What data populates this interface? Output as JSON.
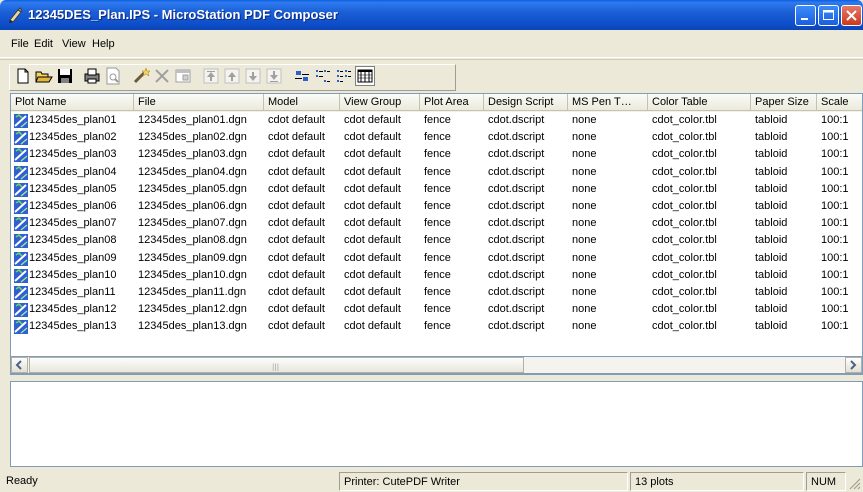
{
  "window": {
    "title": "12345DES_Plan.IPS - MicroStation PDF Composer"
  },
  "menu": [
    "File",
    "Edit",
    "View",
    "Help"
  ],
  "toolbar": {
    "buttons": [
      "new-icon",
      "open-icon",
      "save-icon",
      "print-icon",
      "print-preview-icon",
      "wand-icon",
      "delete-icon",
      "properties-icon",
      "move-top-icon",
      "move-up-icon",
      "move-down-icon",
      "move-bottom-icon",
      "large-icons-view-icon",
      "small-icons-view-icon",
      "list-view-icon",
      "details-view-icon"
    ]
  },
  "table": {
    "columns": [
      "Plot Name",
      "File",
      "Model",
      "View Group",
      "Plot Area",
      "Design Script",
      "MS Pen T…",
      "Color Table",
      "Paper Size",
      "Scale"
    ],
    "rows": [
      [
        "12345des_plan01",
        "12345des_plan01.dgn",
        "cdot default",
        "cdot default",
        "fence",
        "cdot.dscript",
        "none",
        "cdot_color.tbl",
        "tabloid",
        "100:1"
      ],
      [
        "12345des_plan02",
        "12345des_plan02.dgn",
        "cdot default",
        "cdot default",
        "fence",
        "cdot.dscript",
        "none",
        "cdot_color.tbl",
        "tabloid",
        "100:1"
      ],
      [
        "12345des_plan03",
        "12345des_plan03.dgn",
        "cdot default",
        "cdot default",
        "fence",
        "cdot.dscript",
        "none",
        "cdot_color.tbl",
        "tabloid",
        "100:1"
      ],
      [
        "12345des_plan04",
        "12345des_plan04.dgn",
        "cdot default",
        "cdot default",
        "fence",
        "cdot.dscript",
        "none",
        "cdot_color.tbl",
        "tabloid",
        "100:1"
      ],
      [
        "12345des_plan05",
        "12345des_plan05.dgn",
        "cdot default",
        "cdot default",
        "fence",
        "cdot.dscript",
        "none",
        "cdot_color.tbl",
        "tabloid",
        "100:1"
      ],
      [
        "12345des_plan06",
        "12345des_plan06.dgn",
        "cdot default",
        "cdot default",
        "fence",
        "cdot.dscript",
        "none",
        "cdot_color.tbl",
        "tabloid",
        "100:1"
      ],
      [
        "12345des_plan07",
        "12345des_plan07.dgn",
        "cdot default",
        "cdot default",
        "fence",
        "cdot.dscript",
        "none",
        "cdot_color.tbl",
        "tabloid",
        "100:1"
      ],
      [
        "12345des_plan08",
        "12345des_plan08.dgn",
        "cdot default",
        "cdot default",
        "fence",
        "cdot.dscript",
        "none",
        "cdot_color.tbl",
        "tabloid",
        "100:1"
      ],
      [
        "12345des_plan09",
        "12345des_plan09.dgn",
        "cdot default",
        "cdot default",
        "fence",
        "cdot.dscript",
        "none",
        "cdot_color.tbl",
        "tabloid",
        "100:1"
      ],
      [
        "12345des_plan10",
        "12345des_plan10.dgn",
        "cdot default",
        "cdot default",
        "fence",
        "cdot.dscript",
        "none",
        "cdot_color.tbl",
        "tabloid",
        "100:1"
      ],
      [
        "12345des_plan11",
        "12345des_plan11.dgn",
        "cdot default",
        "cdot default",
        "fence",
        "cdot.dscript",
        "none",
        "cdot_color.tbl",
        "tabloid",
        "100:1"
      ],
      [
        "12345des_plan12",
        "12345des_plan12.dgn",
        "cdot default",
        "cdot default",
        "fence",
        "cdot.dscript",
        "none",
        "cdot_color.tbl",
        "tabloid",
        "100:1"
      ],
      [
        "12345des_plan13",
        "12345des_plan13.dgn",
        "cdot default",
        "cdot default",
        "fence",
        "cdot.dscript",
        "none",
        "cdot_color.tbl",
        "tabloid",
        "100:1"
      ]
    ]
  },
  "statusbar": {
    "ready": "Ready",
    "printer": "Printer: CutePDF Writer",
    "count": "13 plots",
    "num": "NUM"
  },
  "colors": {
    "titlebar": "#0b4fd0",
    "face": "#ece9d8",
    "border": "#7f9db9"
  }
}
